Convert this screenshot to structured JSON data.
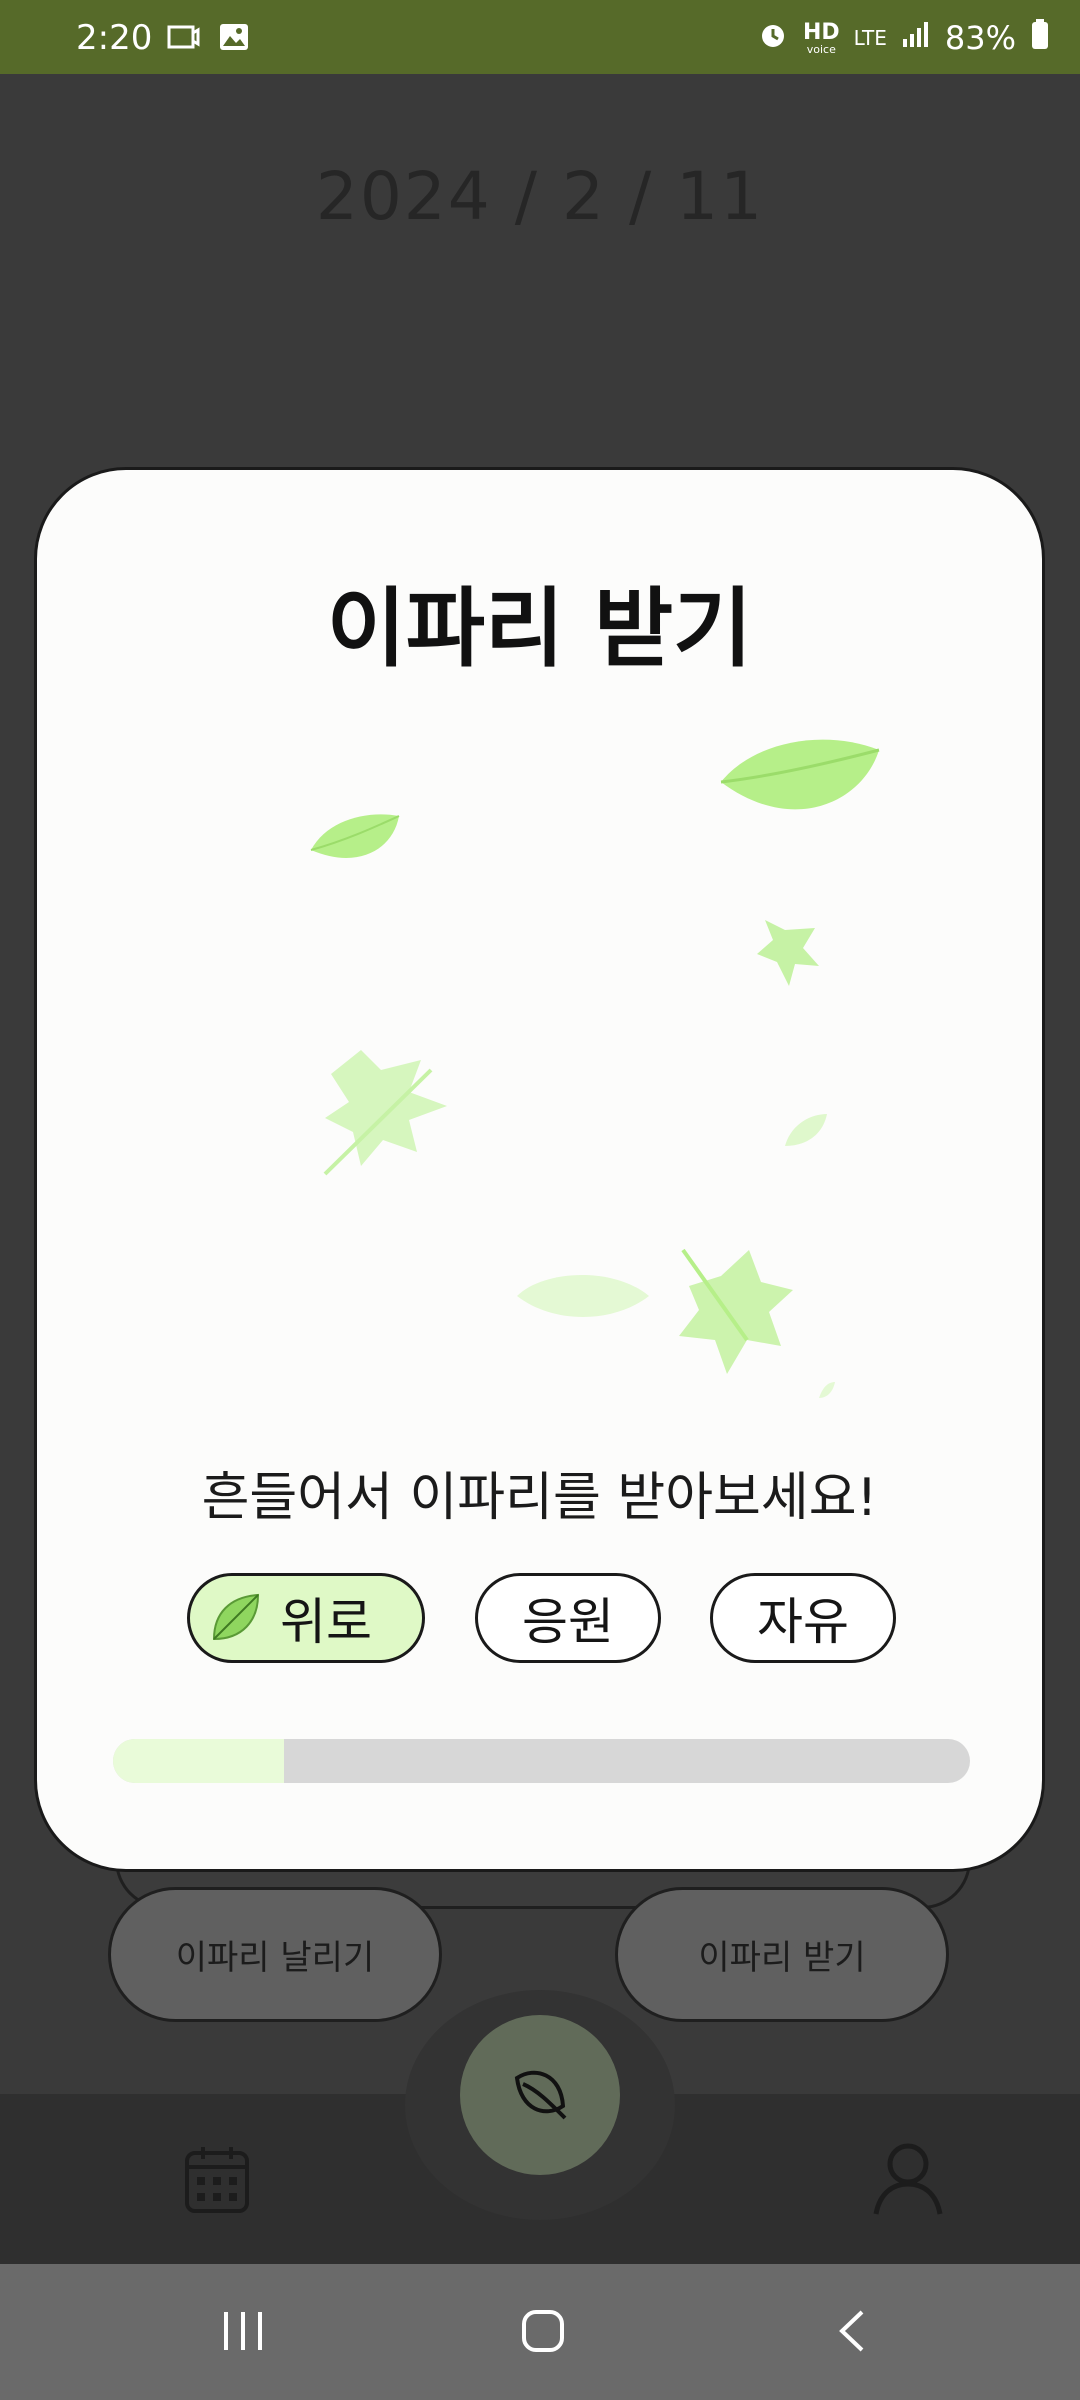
{
  "status_bar": {
    "time": "2:20",
    "network": "LTE",
    "hd_label": "HD",
    "hd_sub": "voice",
    "battery": "83%",
    "icons": [
      "screen-record-icon",
      "gallery-icon",
      "alarm-icon",
      "signal-icon",
      "battery-icon"
    ]
  },
  "header": {
    "date": "2024 / 2 / 11"
  },
  "modal": {
    "title": "이파리 받기",
    "instruction": "흔들어서 이파리를 받아보세요!",
    "options": [
      {
        "label": "위로",
        "selected": true,
        "icon": "leaf-icon"
      },
      {
        "label": "응원",
        "selected": false
      },
      {
        "label": "자유",
        "selected": false
      }
    ],
    "progress": 0.2
  },
  "actions": {
    "send_label": "이파리 날리기",
    "receive_label": "이파리 받기"
  },
  "bottom_nav": {
    "items": [
      "calendar-icon",
      "leaf-icon",
      "profile-icon"
    ]
  },
  "colors": {
    "status_bar": "#566a29",
    "leaf_green": "#b9f08e",
    "selected_option": "#dff9c6",
    "progress_fill": "#e9fbd9"
  }
}
